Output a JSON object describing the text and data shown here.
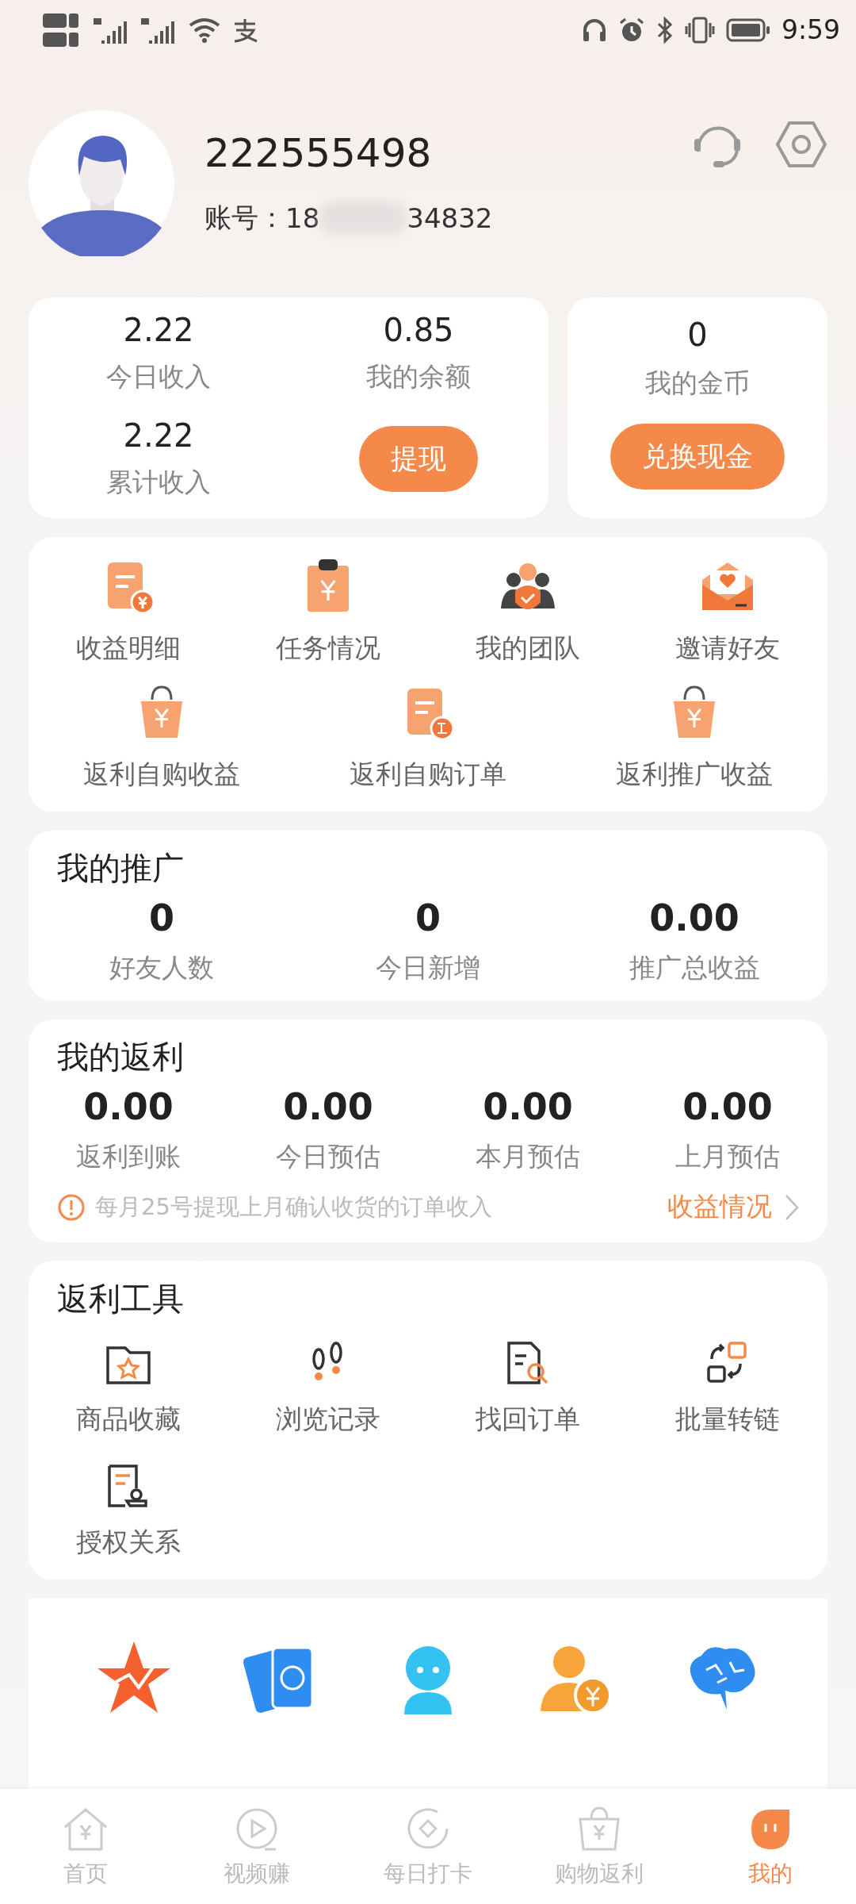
{
  "status_bar": {
    "time": "9:59"
  },
  "profile": {
    "name": "222555498",
    "account_label": "账号：",
    "account_start": "18",
    "account_end": "34832"
  },
  "wallet": {
    "stats": [
      {
        "value": "2.22",
        "label": "今日收入"
      },
      {
        "value": "0.85",
        "label": "我的余额"
      },
      {
        "value": "2.22",
        "label": "累计收入"
      }
    ],
    "withdraw_button": "提现"
  },
  "coins": {
    "value": "0",
    "label": "我的金币",
    "button": "兑换现金"
  },
  "shortcuts": [
    "收益明细",
    "任务情况",
    "我的团队",
    "邀请好友",
    "返利自购收益",
    "返利自购订单",
    "返利推广收益"
  ],
  "promotion": {
    "title": "我的推广",
    "stats": [
      {
        "value": "0",
        "label": "好友人数"
      },
      {
        "value": "0",
        "label": "今日新增"
      },
      {
        "value": "0.00",
        "label": "推广总收益"
      }
    ]
  },
  "rebate": {
    "title": "我的返利",
    "stats": [
      {
        "value": "0.00",
        "label": "返利到账"
      },
      {
        "value": "0.00",
        "label": "今日预估"
      },
      {
        "value": "0.00",
        "label": "本月预估"
      },
      {
        "value": "0.00",
        "label": "上月预估"
      }
    ],
    "notice": "每月25号提现上月确认收货的订单收入",
    "link": "收益情况"
  },
  "tools": {
    "title": "返利工具",
    "items": [
      "商品收藏",
      "浏览记录",
      "找回订单",
      "批量转链",
      "授权关系"
    ]
  },
  "bottom_nav": [
    {
      "label": "首页",
      "selected": false
    },
    {
      "label": "视频赚",
      "selected": false
    },
    {
      "label": "每日打卡",
      "selected": false
    },
    {
      "label": "购物返利",
      "selected": false
    },
    {
      "label": "我的",
      "selected": true
    }
  ]
}
